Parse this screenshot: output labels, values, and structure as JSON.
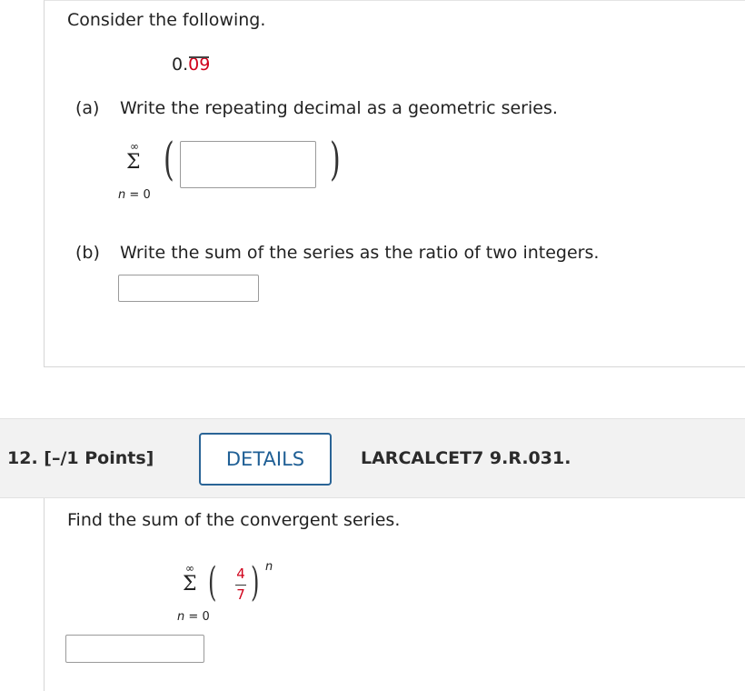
{
  "problem11": {
    "intro": "Consider the following.",
    "decimal_lead": "0.",
    "decimal_repeat": "09",
    "part_a": {
      "label": "(a)",
      "text": "Write the repeating decimal as a geometric series."
    },
    "part_b": {
      "label": "(b)",
      "text": "Write the sum of the series as the ratio of two integers."
    },
    "sum_upper": "∞",
    "sum_symbol": "Σ",
    "sum_var": "n",
    "sum_eq": "=",
    "sum_lower": "0",
    "answer_a": "",
    "answer_b": ""
  },
  "problem12": {
    "number": "12.",
    "points": "[–/1 Points]",
    "details_button": "DETAILS",
    "code": "LARCALCET7 9.R.031.",
    "prompt": "Find the sum of the convergent series.",
    "sum_upper": "∞",
    "sum_symbol": "Σ",
    "sum_var": "n",
    "sum_eq": "=",
    "sum_lower": "0",
    "frac_num": "4",
    "frac_den": "7",
    "exponent": "n",
    "answer": ""
  },
  "colors": {
    "accent_red": "#d0021b",
    "button_blue": "#1f5f95",
    "header_bg": "#f2f2f2"
  }
}
